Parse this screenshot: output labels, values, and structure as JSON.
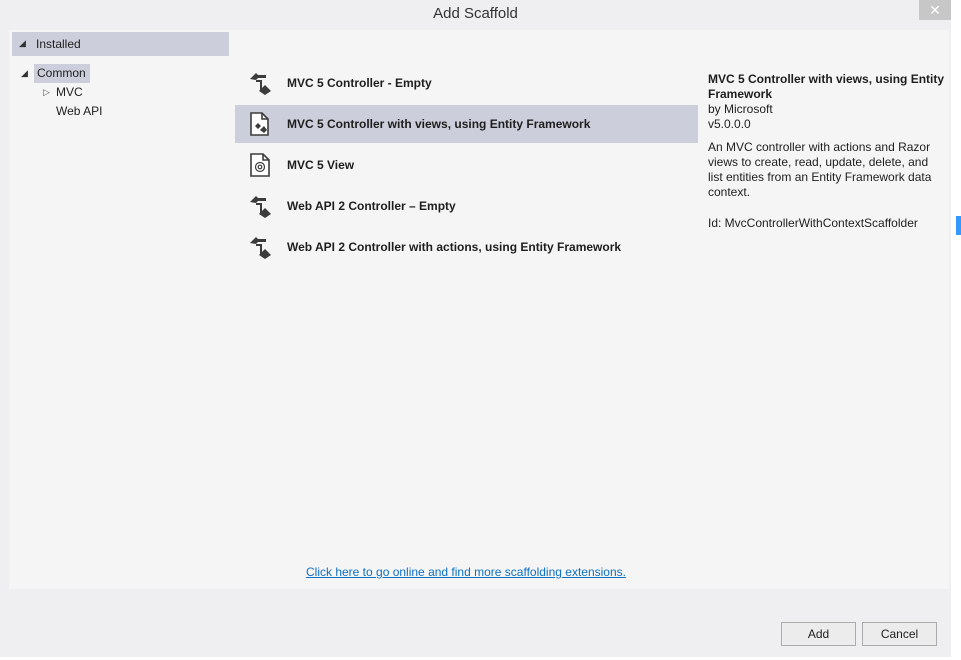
{
  "window": {
    "title": "Add Scaffold",
    "close_glyph": "✕"
  },
  "sidebar": {
    "header": "Installed",
    "items": [
      {
        "label": "Common",
        "selected": true,
        "expanded": true
      },
      {
        "label": "MVC",
        "selected": false,
        "expanded": false
      },
      {
        "label": "Web API",
        "selected": false
      }
    ]
  },
  "scaffolds": [
    {
      "label": "MVC 5 Controller - Empty",
      "icon": "controller-icon",
      "selected": false
    },
    {
      "label": "MVC 5 Controller with views, using Entity Framework",
      "icon": "controller-views-icon",
      "selected": true
    },
    {
      "label": "MVC 5 View",
      "icon": "view-icon",
      "selected": false
    },
    {
      "label": "Web API 2 Controller – Empty",
      "icon": "controller-icon",
      "selected": false
    },
    {
      "label": "Web API 2 Controller with actions, using Entity Framework",
      "icon": "controller-icon",
      "selected": false
    }
  ],
  "details": {
    "title": "MVC 5 Controller with views, using Entity Framework",
    "author": "by Microsoft",
    "version": "v5.0.0.0",
    "description": "An MVC controller with actions and Razor views to create, read, update, delete, and list entities from an Entity Framework data context.",
    "id": "Id: MvcControllerWithContextScaffolder"
  },
  "online_link": "Click here to go online and find more scaffolding extensions.",
  "buttons": {
    "add": "Add",
    "cancel": "Cancel"
  },
  "colors": {
    "selection": "#cccedb",
    "link": "#0e70c0",
    "dialog_bg": "#efeff2"
  }
}
